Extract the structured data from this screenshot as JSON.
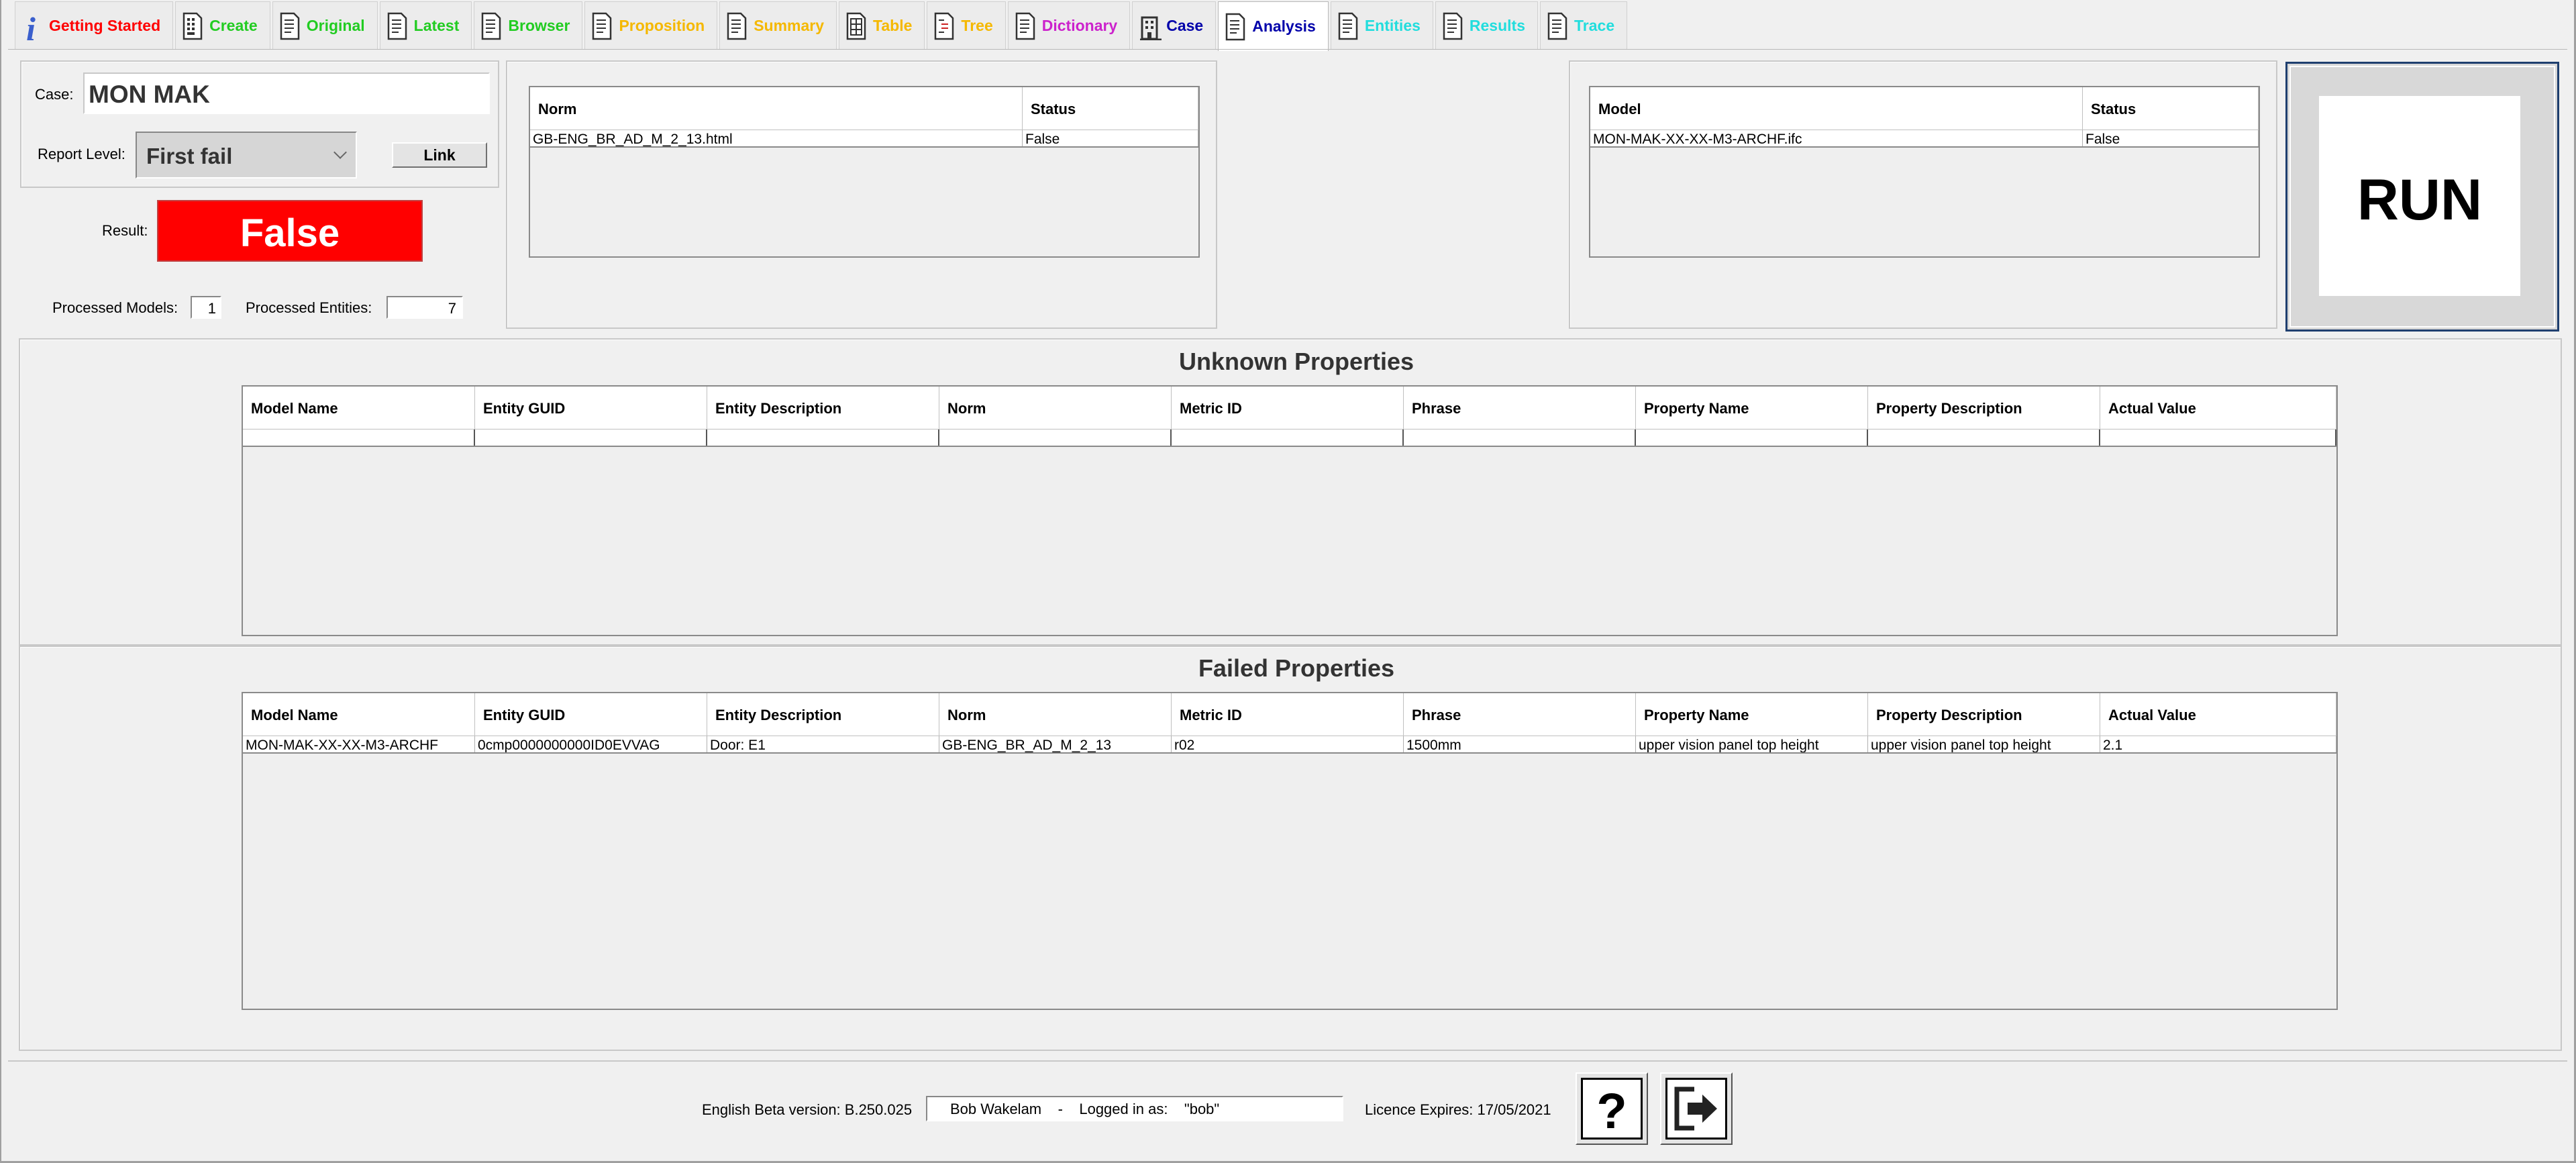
{
  "tabs": [
    {
      "label": "Getting Started",
      "icon": "info-icon",
      "color": "#ff0000"
    },
    {
      "label": "Create",
      "icon": "calculator-doc-icon",
      "color": "#22cc22"
    },
    {
      "label": "Original",
      "icon": "document-icon",
      "color": "#22cc22"
    },
    {
      "label": "Latest",
      "icon": "document-icon",
      "color": "#22cc22"
    },
    {
      "label": "Browser",
      "icon": "document-icon",
      "color": "#22cc22"
    },
    {
      "label": "Proposition",
      "icon": "document-icon",
      "color": "#f5b800"
    },
    {
      "label": "Summary",
      "icon": "document-icon",
      "color": "#f5b800"
    },
    {
      "label": "Table",
      "icon": "table-doc-icon",
      "color": "#f5b800"
    },
    {
      "label": "Tree",
      "icon": "tree-doc-icon",
      "color": "#f5b800"
    },
    {
      "label": "Dictionary",
      "icon": "document-icon",
      "color": "#cc22cc"
    },
    {
      "label": "Case",
      "icon": "building-icon",
      "color": "#0000aa"
    },
    {
      "label": "Analysis",
      "icon": "document-icon",
      "color": "#0000aa",
      "active": true
    },
    {
      "label": "Entities",
      "icon": "document-icon",
      "color": "#22dddd"
    },
    {
      "label": "Results",
      "icon": "document-icon",
      "color": "#22dddd"
    },
    {
      "label": "Trace",
      "icon": "document-icon",
      "color": "#22dddd"
    }
  ],
  "case": {
    "label": "Case:",
    "value": "MON MAK",
    "report_level_label": "Report Level:",
    "report_level_value": "First fail",
    "link_label": "Link",
    "result_label": "Result:",
    "result_value": "False",
    "result_color": "#ff0000",
    "processed_models_label": "Processed Models:",
    "processed_models_value": "1",
    "processed_entities_label": "Processed Entities:",
    "processed_entities_value": "7"
  },
  "norms_table": {
    "headers": [
      "Norm",
      "Status"
    ],
    "rows": [
      [
        "GB-ENG_BR_AD_M_2_13.html",
        "False"
      ]
    ]
  },
  "models_table": {
    "headers": [
      "Model",
      "Status"
    ],
    "rows": [
      [
        "MON-MAK-XX-XX-M3-ARCHF.ifc",
        "False"
      ]
    ]
  },
  "run_label": "RUN",
  "unknown": {
    "title": "Unknown Properties",
    "headers": [
      "Model Name",
      "Entity GUID",
      "Entity Description",
      "Norm",
      "Metric ID",
      "Phrase",
      "Property Name",
      "Property Description",
      "Actual Value"
    ],
    "rows": [
      [
        "",
        "",
        "",
        "",
        "",
        "",
        "",
        "",
        ""
      ]
    ]
  },
  "failed": {
    "title": "Failed Properties",
    "headers": [
      "Model Name",
      "Entity GUID",
      "Entity Description",
      "Norm",
      "Metric ID",
      "Phrase",
      "Property Name",
      "Property Description",
      "Actual Value"
    ],
    "rows": [
      [
        "MON-MAK-XX-XX-M3-ARCHF",
        "0cmp0000000000ID0EVVAG",
        "Door: E1",
        "GB-ENG_BR_AD_M_2_13",
        "r02",
        "1500mm",
        "upper vision panel top height",
        "upper vision panel top height",
        "2.1"
      ]
    ]
  },
  "footer": {
    "version": "English Beta version: B.250.025",
    "user": "Bob Wakelam    -    Logged in as:    \"bob\"",
    "licence": "Licence Expires: 17/05/2021",
    "help_label": "?",
    "exit_icon": "exit-icon"
  }
}
